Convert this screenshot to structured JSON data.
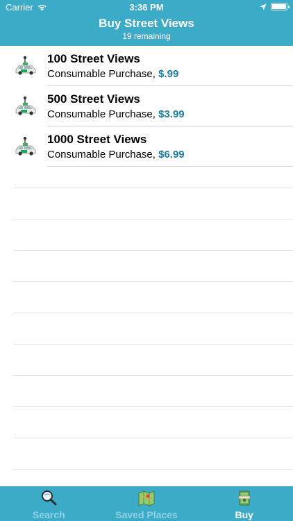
{
  "status_bar": {
    "carrier": "Carrier",
    "time": "3:36 PM"
  },
  "nav": {
    "title": "Buy Street Views",
    "subtitle": "19 remaining"
  },
  "products": [
    {
      "title": "100 Street Views",
      "kind": "Consumable Purchase,",
      "price": "$.99"
    },
    {
      "title": "500 Street Views",
      "kind": "Consumable Purchase,",
      "price": "$3.99"
    },
    {
      "title": "1000 Street Views",
      "kind": "Consumable Purchase,",
      "price": "$6.99"
    }
  ],
  "tabs": [
    {
      "label": "Search",
      "icon": "magnifier-icon",
      "active": false
    },
    {
      "label": "Saved Places",
      "icon": "map-icon",
      "active": false
    },
    {
      "label": "Buy",
      "icon": "cash-icon",
      "active": true
    }
  ],
  "colors": {
    "bar": "#3cabc8",
    "price": "#1d7c9e",
    "tab_inactive": "#8fd3e3"
  }
}
